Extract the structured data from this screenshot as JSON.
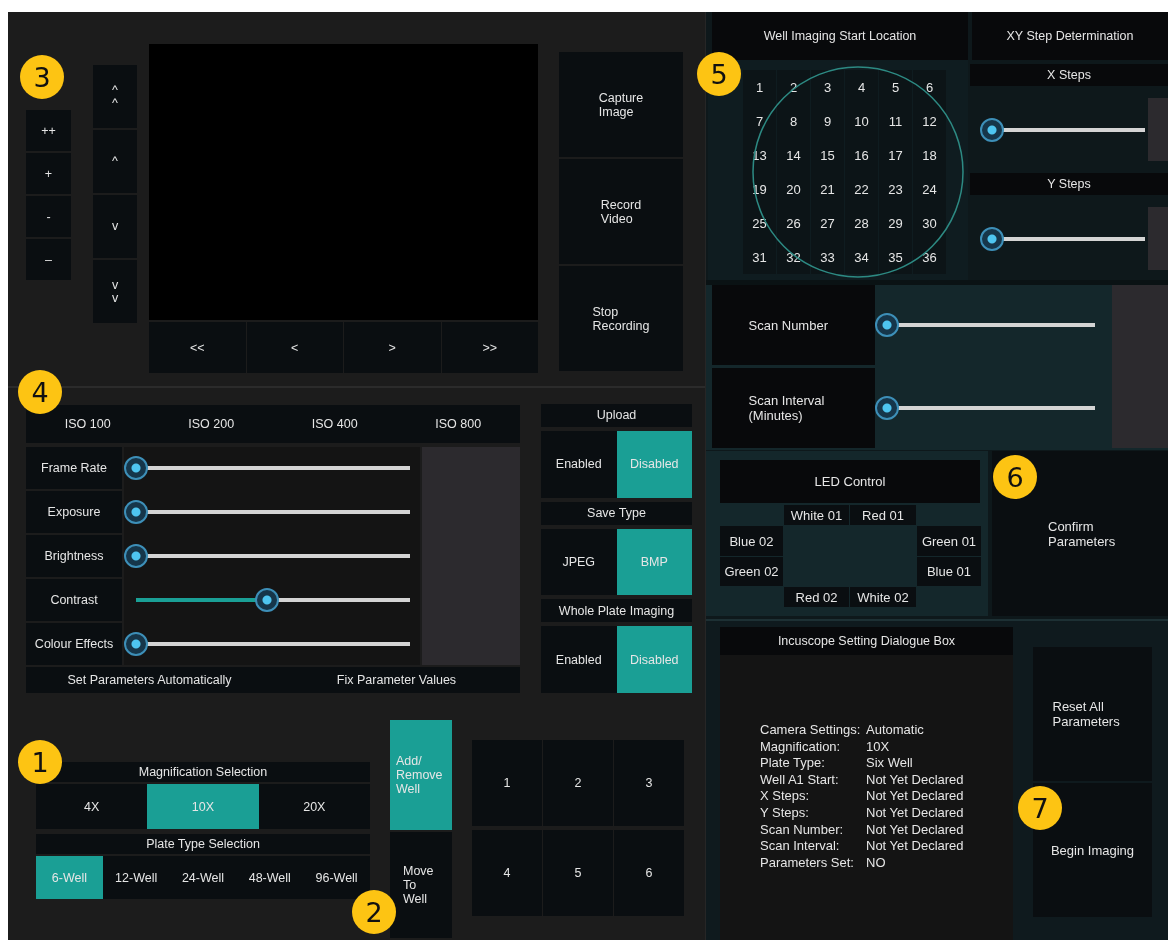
{
  "callouts": [
    {
      "label": "1"
    },
    {
      "label": "2"
    },
    {
      "label": "3"
    },
    {
      "label": "4"
    },
    {
      "label": "5"
    },
    {
      "label": "6"
    },
    {
      "label": "7"
    }
  ],
  "zoom_buttons": [
    "++",
    "+",
    "-",
    "–"
  ],
  "pan_buttons": [
    "^ ^",
    "^",
    "v",
    "v v"
  ],
  "camera": {
    "nav_buttons": [
      "<<",
      "<",
      ">",
      ">>"
    ]
  },
  "capture_buttons": [
    "Capture Image",
    "Record Video",
    "Stop Recording"
  ],
  "iso": [
    {
      "label": "ISO 100",
      "selected": false
    },
    {
      "label": "ISO 200",
      "selected": false
    },
    {
      "label": "ISO 400",
      "selected": false
    },
    {
      "label": "ISO 800",
      "selected": false
    }
  ],
  "camera_sliders": [
    {
      "label": "Frame Rate",
      "level": 0
    },
    {
      "label": "Exposure",
      "level": 0
    },
    {
      "label": "Brightness",
      "level": 0
    },
    {
      "label": "Contrast",
      "level": 0.5
    },
    {
      "label": "Colour Effects",
      "level": 0
    }
  ],
  "parameter_buttons": [
    "Set Parameters Automatically",
    "Fix Parameter Values"
  ],
  "toggles": [
    {
      "title": "Upload",
      "options": [
        {
          "label": "Enabled",
          "selected": false
        },
        {
          "label": "Disabled",
          "selected": true
        }
      ]
    },
    {
      "title": "Save Type",
      "options": [
        {
          "label": "JPEG",
          "selected": false
        },
        {
          "label": "BMP",
          "selected": true
        }
      ]
    },
    {
      "title": "Whole Plate Imaging",
      "options": [
        {
          "label": "Enabled",
          "selected": false
        },
        {
          "label": "Disabled",
          "selected": true
        }
      ]
    }
  ],
  "magnification": {
    "title": "Magnification Selection",
    "options": [
      {
        "label": "4X",
        "selected": false
      },
      {
        "label": "10X",
        "selected": true
      },
      {
        "label": "20X",
        "selected": false
      }
    ]
  },
  "plate_type": {
    "title": "Plate Type Selection",
    "options": [
      {
        "label": "6-Well",
        "selected": true
      },
      {
        "label": "12-Well",
        "selected": false
      },
      {
        "label": "24-Well",
        "selected": false
      },
      {
        "label": "48-Well",
        "selected": false
      },
      {
        "label": "96-Well",
        "selected": false
      }
    ]
  },
  "well_actions": [
    {
      "label": "Add/ Remove Well",
      "selected": true
    },
    {
      "label": "Move To Well",
      "selected": false
    }
  ],
  "wells": [
    {
      "label": "1",
      "selected": false
    },
    {
      "label": "2",
      "selected": false
    },
    {
      "label": "3",
      "selected": false
    },
    {
      "label": "4",
      "selected": false
    },
    {
      "label": "5",
      "selected": false
    },
    {
      "label": "6",
      "selected": false
    }
  ],
  "well_start": {
    "title": "Well Imaging Start Location",
    "cells": [
      {
        "label": "1",
        "selected": false
      },
      {
        "label": "2",
        "selected": false
      },
      {
        "label": "3",
        "selected": false
      },
      {
        "label": "4",
        "selected": false
      },
      {
        "label": "5",
        "selected": false
      },
      {
        "label": "6",
        "selected": false
      },
      {
        "label": "7",
        "selected": false
      },
      {
        "label": "8",
        "selected": false
      },
      {
        "label": "9",
        "selected": false
      },
      {
        "label": "10",
        "selected": false
      },
      {
        "label": "11",
        "selected": false
      },
      {
        "label": "12",
        "selected": false
      },
      {
        "label": "13",
        "selected": false
      },
      {
        "label": "14",
        "selected": false
      },
      {
        "label": "15",
        "selected": false
      },
      {
        "label": "16",
        "selected": false
      },
      {
        "label": "17",
        "selected": false
      },
      {
        "label": "18",
        "selected": false
      },
      {
        "label": "19",
        "selected": false
      },
      {
        "label": "20",
        "selected": false
      },
      {
        "label": "21",
        "selected": false
      },
      {
        "label": "22",
        "selected": false
      },
      {
        "label": "23",
        "selected": false
      },
      {
        "label": "24",
        "selected": false
      },
      {
        "label": "25",
        "selected": false
      },
      {
        "label": "26",
        "selected": false
      },
      {
        "label": "27",
        "selected": false
      },
      {
        "label": "28",
        "selected": false
      },
      {
        "label": "29",
        "selected": false
      },
      {
        "label": "30",
        "selected": false
      },
      {
        "label": "31",
        "selected": false
      },
      {
        "label": "32",
        "selected": false
      },
      {
        "label": "33",
        "selected": false
      },
      {
        "label": "34",
        "selected": false
      },
      {
        "label": "35",
        "selected": false
      },
      {
        "label": "36",
        "selected": false
      }
    ]
  },
  "xy_steps": {
    "title": "XY Step Determination",
    "sliders": [
      {
        "label": "X Steps",
        "level": 0
      },
      {
        "label": "Y Steps",
        "level": 0
      }
    ]
  },
  "scan": [
    {
      "label": "Scan Number",
      "level": 0
    },
    {
      "label": "Scan Interval (Minutes)",
      "level": 0
    }
  ],
  "led": {
    "title": "LED Control",
    "buttons": [
      "White 01",
      "Red 01",
      "Blue 02",
      "Green 01",
      "Green 02",
      "Blue 01",
      "Red 02",
      "White 02"
    ]
  },
  "confirm_button": "Confirm Parameters",
  "dialogue": {
    "title": "Incuscope Setting Dialogue Box",
    "lines": [
      {
        "label": "Camera Settings:",
        "value": "Automatic"
      },
      {
        "label": "Magnification:",
        "value": "10X"
      },
      {
        "label": "Plate Type:",
        "value": "Six Well"
      },
      {
        "label": "Well A1 Start:",
        "value": "Not Yet Declared"
      },
      {
        "label": "X Steps:",
        "value": "Not Yet Declared"
      },
      {
        "label": "Y Steps:",
        "value": "Not Yet Declared"
      },
      {
        "label": "Scan Number:",
        "value": "Not Yet Declared"
      },
      {
        "label": "Scan Interval:",
        "value": "Not Yet Declared"
      },
      {
        "label": "Parameters Set:",
        "value": "NO"
      }
    ]
  },
  "reset_button": "Reset All Parameters",
  "begin_button": "Begin Imaging"
}
